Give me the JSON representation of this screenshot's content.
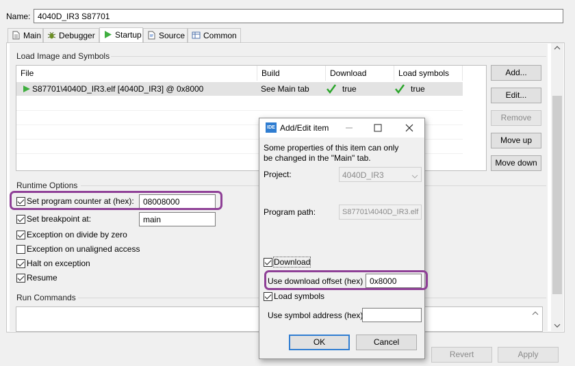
{
  "name": {
    "label": "Name:",
    "value": "4040D_IR3 S87701"
  },
  "tabs": [
    {
      "label": "Main",
      "icon": "document-icon"
    },
    {
      "label": "Debugger",
      "icon": "bug-icon"
    },
    {
      "label": "Startup",
      "icon": "play-icon"
    },
    {
      "label": "Source",
      "icon": "source-icon"
    },
    {
      "label": "Common",
      "icon": "table-icon"
    }
  ],
  "active_tab": "Startup",
  "load_image": {
    "title": "Load Image and Symbols",
    "columns": [
      "File",
      "Build",
      "Download",
      "Load symbols"
    ],
    "rows": [
      {
        "file": "S87701\\4040D_IR3.elf [4040D_IR3]  @ 0x8000",
        "build": "See Main tab",
        "download": "true",
        "load_symbols": "true"
      }
    ],
    "buttons": {
      "add": "Add...",
      "edit": "Edit...",
      "remove": "Remove",
      "move_up": "Move up",
      "move_down": "Move down"
    }
  },
  "runtime": {
    "title": "Runtime Options",
    "set_pc_label": "Set program counter at (hex):",
    "set_pc_value": "08008000",
    "set_pc_checked": true,
    "set_bp_label": "Set breakpoint at:",
    "set_bp_value": "main",
    "set_bp_checked": true,
    "div_zero_label": "Exception on divide by zero",
    "div_zero_checked": true,
    "unaligned_label": "Exception on unaligned access",
    "unaligned_checked": false,
    "halt_label": "Halt on exception",
    "halt_checked": true,
    "resume_label": "Resume",
    "resume_checked": true
  },
  "run_commands": {
    "title": "Run Commands"
  },
  "footer": {
    "revert": "Revert",
    "apply": "Apply"
  },
  "dialog": {
    "icon_text": "IDE",
    "title": "Add/Edit item",
    "note_line1": "Some properties of this item can only",
    "note_line2": "be changed in the \"Main\" tab.",
    "project_label": "Project:",
    "project_value": "4040D_IR3",
    "program_path_label": "Program path:",
    "program_path_value": "S87701\\4040D_IR3.elf",
    "download_label": "Download",
    "download_checked": true,
    "offset_label": "Use download offset (hex)",
    "offset_checked": true,
    "offset_value": "0x8000",
    "load_symbols_label": "Load symbols",
    "load_symbols_checked": true,
    "symbol_addr_label": "Use symbol address (hex)",
    "symbol_addr_value": "",
    "ok": "OK",
    "cancel": "Cancel"
  },
  "colors": {
    "highlight": "#8e3f96",
    "check_green": "#2aa52a",
    "play_green": "#3fae3f",
    "row_selected": "#e3e3e3"
  }
}
